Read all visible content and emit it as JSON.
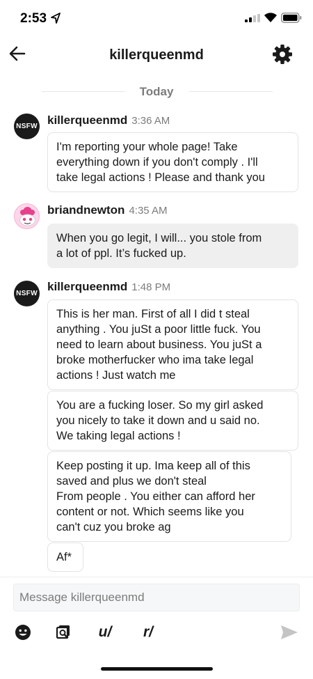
{
  "status_bar": {
    "time": "2:53"
  },
  "header": {
    "title": "killerqueenmd"
  },
  "date_divider": "Today",
  "messages": [
    {
      "author": "killerqueenmd",
      "time": "3:36 AM",
      "avatar_label": "NSFW",
      "bubbles": [
        "I'm reporting your whole page! Take\neverything down if you don't comply . I'll\ntake legal actions ! Please and thank you"
      ]
    },
    {
      "author": "briandnewton",
      "time": "4:35 AM",
      "bubbles": [
        "When you go legit, I will... you stole from\na lot of ppl. It’s fucked up."
      ]
    },
    {
      "author": "killerqueenmd",
      "time": "1:48 PM",
      "avatar_label": "NSFW",
      "bubbles": [
        "This is her man. First of all I did t steal\nanything . You juSt a poor little fuck. You\nneed to learn about business. You juSt a\nbroke motherfucker who ima take legal\nactions ! Just watch me",
        "You are a fucking loser. So my girl asked\nyou nicely to take it down and u said no.\nWe taking legal actions !",
        "Keep posting it up. Ima keep all of this\nsaved and plus we don't steal\nFrom people . You either can afford her\ncontent or not. Which seems like you\ncan't cuz you broke ag",
        "Af*"
      ]
    }
  ],
  "composer": {
    "placeholder": "Message killerqueenmd",
    "toolbar": {
      "user_label": "u/",
      "subreddit_label": "r/"
    }
  },
  "colors": {
    "text": "#1a1a1b",
    "muted": "#7c7c7c",
    "own_bubble": "#efefef",
    "send_inactive": "#c4c4c4"
  }
}
